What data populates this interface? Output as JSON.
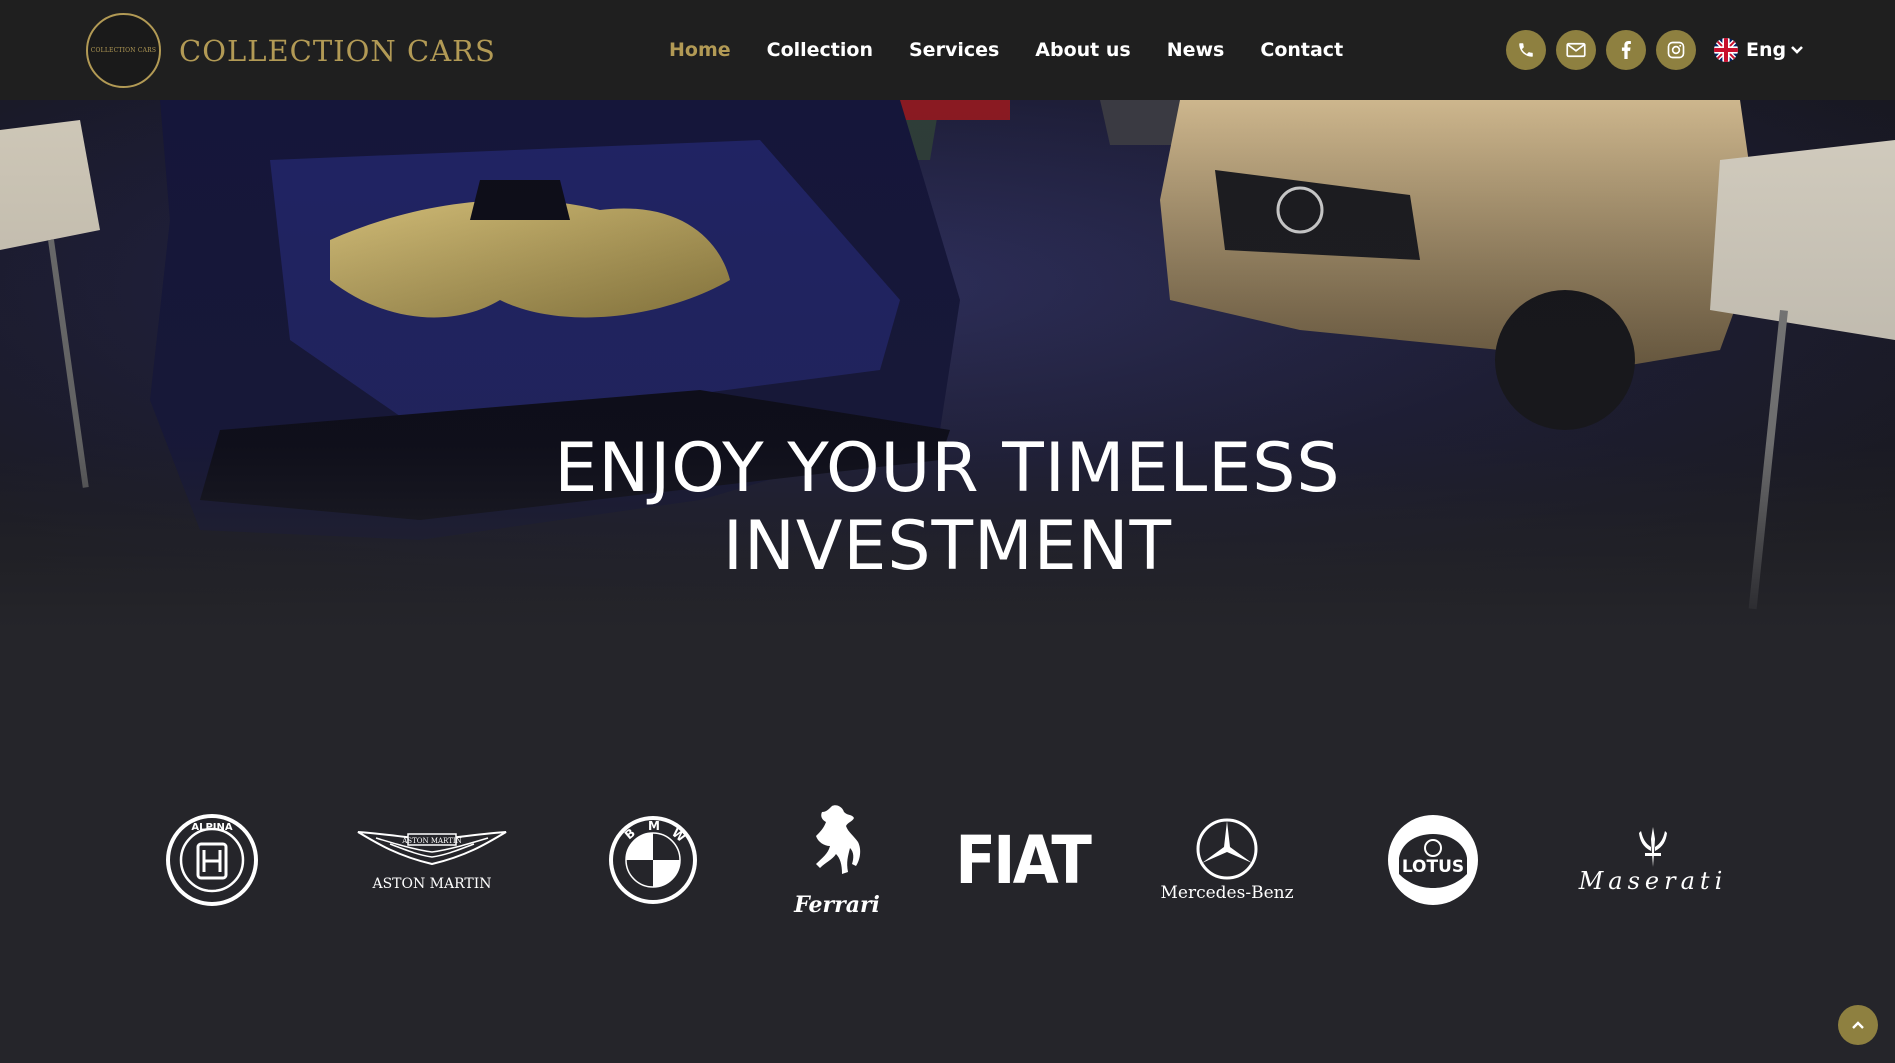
{
  "header": {
    "logo_small_text": "COLLECTION CARS",
    "logo_text": "COLLECTION CARS",
    "nav": [
      {
        "label": "Home",
        "active": true
      },
      {
        "label": "Collection"
      },
      {
        "label": "Services"
      },
      {
        "label": "About us"
      },
      {
        "label": "News"
      },
      {
        "label": "Contact"
      }
    ],
    "icons": [
      "phone-icon",
      "mail-icon",
      "facebook-icon",
      "instagram-icon"
    ],
    "language": "Eng"
  },
  "hero": {
    "title_line1": "ENJOY YOUR TIMELESS",
    "title_line2": "INVESTMENT"
  },
  "brands": {
    "items": [
      {
        "name": "alpina-logo",
        "label": ""
      },
      {
        "name": "aston-martin-logo",
        "label": "ASTON MARTIN"
      },
      {
        "name": "bmw-logo",
        "label": ""
      },
      {
        "name": "ferrari-logo",
        "label": "Ferrari"
      },
      {
        "name": "fiat-logo",
        "label": "FIAT"
      },
      {
        "name": "mercedes-benz-logo",
        "label": "Mercedes-Benz"
      },
      {
        "name": "lotus-logo",
        "label": "LOTUS"
      },
      {
        "name": "maserati-logo",
        "label": "Maserati"
      }
    ]
  },
  "colors": {
    "accent": "#b29a55",
    "icon_bg": "#8e8040",
    "header_bg": "#1f1f1f",
    "page_bg": "#25252a"
  }
}
